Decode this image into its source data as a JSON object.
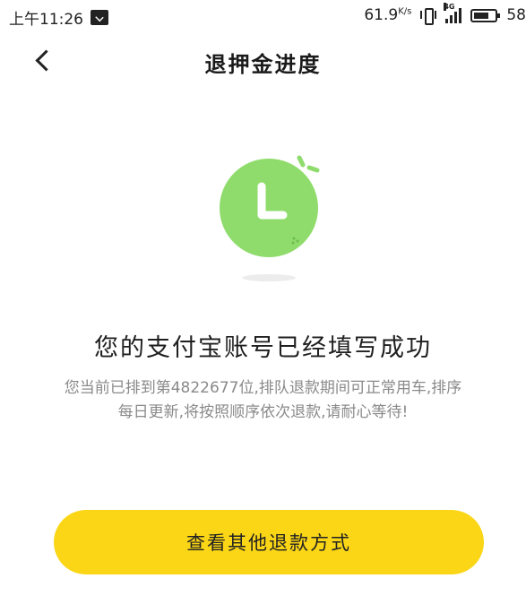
{
  "status_bar": {
    "time": "上午11:26",
    "net_speed_value": "61.9",
    "net_speed_unit": "K/s",
    "network_type": "4G",
    "battery": "58",
    "icons": [
      "notification-icon",
      "vibrate-icon",
      "signal-icon",
      "battery-icon"
    ]
  },
  "header": {
    "title": "退押金进度",
    "back_icon": "chevron-left-icon"
  },
  "illustration": {
    "icon": "clock-icon",
    "colors": {
      "circle": "#8fdc6c",
      "hands": "#ffffff",
      "shadow": "#ececec"
    }
  },
  "message": {
    "title": "您的支付宝账号已经填写成功",
    "line1": "您当前已排到第4822677位,排队退款期间可正常用车,排序",
    "line2": "每日更新,将按照顺序依次退款,请耐心等待!"
  },
  "action": {
    "label": "查看其他退款方式",
    "color": "#fad616"
  }
}
